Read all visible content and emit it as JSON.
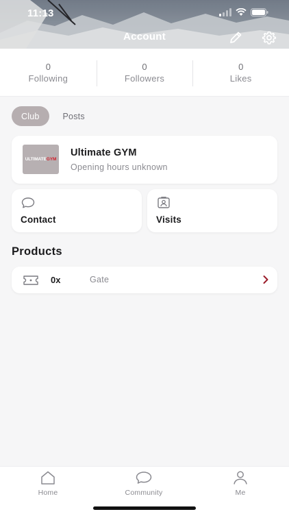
{
  "status_bar": {
    "time": "11:13"
  },
  "header": {
    "title": "Account"
  },
  "stats": [
    {
      "value": "0",
      "label": "Following"
    },
    {
      "value": "0",
      "label": "Followers"
    },
    {
      "value": "0",
      "label": "Likes"
    }
  ],
  "tabs": [
    {
      "label": "Club",
      "active": true
    },
    {
      "label": "Posts",
      "active": false
    }
  ],
  "club": {
    "logo_text_white": "ULTIMATE",
    "logo_text_red": "GYM",
    "name": "Ultimate GYM",
    "hours": "Opening hours unknown"
  },
  "actions": {
    "contact_label": "Contact",
    "visits_label": "Visits"
  },
  "products": {
    "title": "Products",
    "items": [
      {
        "quantity": "0x",
        "name": "Gate"
      }
    ]
  },
  "bottom_nav": [
    {
      "label": "Home",
      "icon": "home-icon"
    },
    {
      "label": "Community",
      "icon": "chat-bubble-icon"
    },
    {
      "label": "Me",
      "icon": "user-icon"
    }
  ],
  "colors": {
    "tab_active": "#b6aeb0",
    "logo_red": "#d21f2b",
    "chevron": "#9b1c2a"
  }
}
